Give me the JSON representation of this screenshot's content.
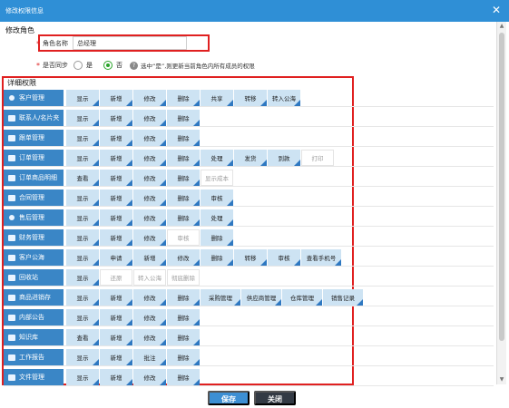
{
  "window": {
    "title": "修改权限信息"
  },
  "section": {
    "label": "修改角色"
  },
  "form": {
    "role_name_label": "角色名称",
    "role_name_value": "总经理",
    "sync_label": "是否同步",
    "opt_yes": "是",
    "opt_no": "否",
    "sync_selected": "否",
    "help_text": "选中“是”,则更新当前角色内所有成员的权限"
  },
  "permissions": {
    "header": "详细权限",
    "rows": [
      {
        "module": "客户管理",
        "icon": "users-icon",
        "perms": [
          {
            "label": "显示",
            "on": true
          },
          {
            "label": "新增",
            "on": true
          },
          {
            "label": "修改",
            "on": true
          },
          {
            "label": "删除",
            "on": true
          },
          {
            "label": "共享",
            "on": true
          },
          {
            "label": "转移",
            "on": true
          },
          {
            "label": "转入公海",
            "on": true
          }
        ]
      },
      {
        "module": "联系人/名片夹",
        "icon": "card-icon",
        "perms": [
          {
            "label": "显示",
            "on": true
          },
          {
            "label": "新增",
            "on": true
          },
          {
            "label": "修改",
            "on": true
          },
          {
            "label": "删除",
            "on": true
          }
        ]
      },
      {
        "module": "跟单管理",
        "icon": "edit-icon",
        "perms": [
          {
            "label": "显示",
            "on": true
          },
          {
            "label": "新增",
            "on": true
          },
          {
            "label": "修改",
            "on": true
          },
          {
            "label": "删除",
            "on": true
          }
        ]
      },
      {
        "module": "订单管理",
        "icon": "cart-icon",
        "perms": [
          {
            "label": "显示",
            "on": true
          },
          {
            "label": "新增",
            "on": true
          },
          {
            "label": "修改",
            "on": true
          },
          {
            "label": "删除",
            "on": true
          },
          {
            "label": "处理",
            "on": true
          },
          {
            "label": "发货",
            "on": true
          },
          {
            "label": "到款",
            "on": true
          },
          {
            "label": "打印",
            "on": false
          }
        ]
      },
      {
        "module": "订单商品明细",
        "icon": "list-icon",
        "perms": [
          {
            "label": "查看",
            "on": true
          },
          {
            "label": "新增",
            "on": true
          },
          {
            "label": "修改",
            "on": true
          },
          {
            "label": "删除",
            "on": true
          },
          {
            "label": "显示成本",
            "on": false
          }
        ]
      },
      {
        "module": "合同管理",
        "icon": "contract-icon",
        "perms": [
          {
            "label": "显示",
            "on": true
          },
          {
            "label": "新增",
            "on": true
          },
          {
            "label": "修改",
            "on": true
          },
          {
            "label": "删除",
            "on": true
          },
          {
            "label": "审核",
            "on": true
          }
        ]
      },
      {
        "module": "售后管理",
        "icon": "service-icon",
        "perms": [
          {
            "label": "显示",
            "on": true
          },
          {
            "label": "新增",
            "on": true
          },
          {
            "label": "修改",
            "on": true
          },
          {
            "label": "删除",
            "on": true
          },
          {
            "label": "处理",
            "on": true
          }
        ]
      },
      {
        "module": "财务管理",
        "icon": "money-icon",
        "perms": [
          {
            "label": "显示",
            "on": true
          },
          {
            "label": "新增",
            "on": true
          },
          {
            "label": "修改",
            "on": true
          },
          {
            "label": "审核",
            "on": false
          },
          {
            "label": "删除",
            "on": true
          }
        ]
      },
      {
        "module": "客户公海",
        "icon": "pool-icon",
        "perms": [
          {
            "label": "显示",
            "on": true
          },
          {
            "label": "申请",
            "on": true
          },
          {
            "label": "新增",
            "on": true
          },
          {
            "label": "修改",
            "on": true
          },
          {
            "label": "删除",
            "on": true
          },
          {
            "label": "转移",
            "on": true
          },
          {
            "label": "审核",
            "on": true
          },
          {
            "label": "查看手机号",
            "on": true,
            "wide": true
          }
        ]
      },
      {
        "module": "回收站",
        "icon": "trash-icon",
        "perms": [
          {
            "label": "显示",
            "on": true
          },
          {
            "label": "还原",
            "on": false
          },
          {
            "label": "转入公海",
            "on": false
          },
          {
            "label": "彻底删除",
            "on": false
          }
        ]
      },
      {
        "module": "商品进销存",
        "icon": "box-icon",
        "perms": [
          {
            "label": "显示",
            "on": true
          },
          {
            "label": "新增",
            "on": true
          },
          {
            "label": "修改",
            "on": true
          },
          {
            "label": "删除",
            "on": true
          },
          {
            "label": "采购管理",
            "on": true,
            "wide": true
          },
          {
            "label": "供应商管理",
            "on": true,
            "wide": true
          },
          {
            "label": "仓库管理",
            "on": true,
            "wide": true
          },
          {
            "label": "销售记录",
            "on": true,
            "wide": true
          }
        ]
      },
      {
        "module": "内部公告",
        "icon": "notice-icon",
        "perms": [
          {
            "label": "显示",
            "on": true
          },
          {
            "label": "新增",
            "on": true
          },
          {
            "label": "修改",
            "on": true
          },
          {
            "label": "删除",
            "on": true
          }
        ]
      },
      {
        "module": "知识库",
        "icon": "heart-icon",
        "perms": [
          {
            "label": "查看",
            "on": true
          },
          {
            "label": "新增",
            "on": true
          },
          {
            "label": "修改",
            "on": true
          },
          {
            "label": "删除",
            "on": true
          }
        ]
      },
      {
        "module": "工作报告",
        "icon": "report-icon",
        "perms": [
          {
            "label": "显示",
            "on": true
          },
          {
            "label": "新增",
            "on": true
          },
          {
            "label": "批注",
            "on": true
          },
          {
            "label": "删除",
            "on": true
          }
        ]
      },
      {
        "module": "文件管理",
        "icon": "folder-icon",
        "perms": [
          {
            "label": "显示",
            "on": true
          },
          {
            "label": "新增",
            "on": true
          },
          {
            "label": "修改",
            "on": true
          },
          {
            "label": "删除",
            "on": true
          }
        ]
      }
    ]
  },
  "footer": {
    "save": "保存",
    "close": "关闭"
  },
  "colors": {
    "titlebar": "#2f8fd6",
    "module_bg": "#3a86c6",
    "perm_on_bg": "#cde3f3",
    "corner": "#2e78c1",
    "highlight": "#e02020"
  }
}
